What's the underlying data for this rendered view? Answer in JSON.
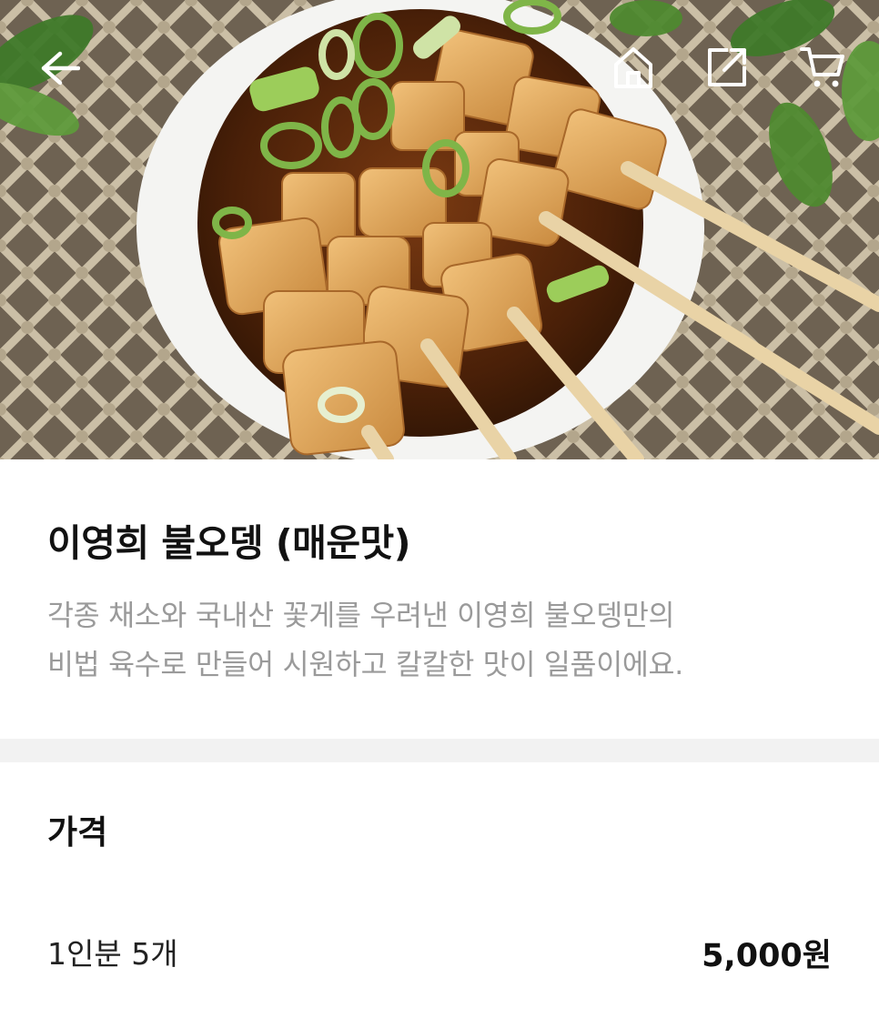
{
  "header": {
    "back_icon": "arrow-left-icon",
    "home_icon": "home-icon",
    "share_icon": "share-icon",
    "cart_icon": "cart-icon"
  },
  "product": {
    "image_subject": "fish cake skewers in broth",
    "title": "이영희 불오뎅 (매운맛)",
    "description_lines": [
      "각종 채소와 국내산 꽃게를 우려낸 이영희 불오뎅만의",
      "비법 육수로 만들어 시원하고 칼칼한 맛이 일품이에요."
    ]
  },
  "price": {
    "heading": "가격",
    "options": [
      {
        "label": "1인분 5개",
        "value": "5,000원"
      }
    ]
  },
  "colors": {
    "description": "#9a9a9a",
    "divider": "#f2f2f2",
    "text": "#111111"
  }
}
